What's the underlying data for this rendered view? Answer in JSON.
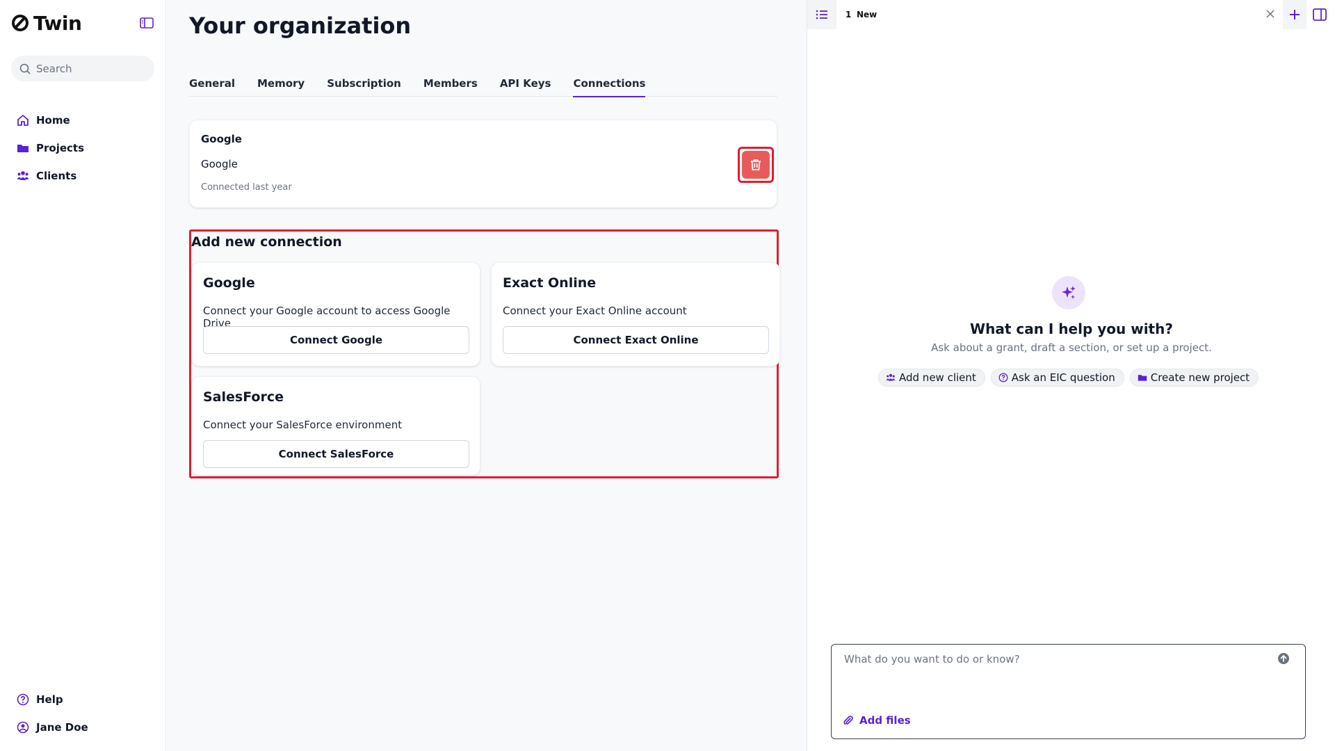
{
  "brand": {
    "name": "Twin",
    "accent": "#5b21d6",
    "danger": "#e85b5b",
    "highlight": "#e11d2e"
  },
  "sidebar": {
    "search_placeholder": "Search",
    "items": [
      {
        "label": "Home",
        "icon": "home-icon"
      },
      {
        "label": "Projects",
        "icon": "folder-icon"
      },
      {
        "label": "Clients",
        "icon": "users-icon"
      }
    ],
    "bottom": [
      {
        "label": "Help",
        "icon": "help-circle-icon"
      },
      {
        "label": "Jane Doe",
        "icon": "user-circle-icon"
      }
    ]
  },
  "main": {
    "title": "Your organization",
    "tabs": [
      {
        "label": "General",
        "active": false
      },
      {
        "label": "Memory",
        "active": false
      },
      {
        "label": "Subscription",
        "active": false
      },
      {
        "label": "Members",
        "active": false
      },
      {
        "label": "API Keys",
        "active": false
      },
      {
        "label": "Connections",
        "active": true
      }
    ],
    "connected": {
      "title": "Google",
      "name": "Google",
      "time": "Connected last year"
    },
    "add_new": {
      "title": "Add new connection",
      "cards": [
        {
          "title": "Google",
          "description": "Connect your Google account to access Google Drive",
          "button": "Connect Google"
        },
        {
          "title": "Exact Online",
          "description": "Connect your Exact Online account",
          "button": "Connect Exact Online"
        },
        {
          "title": "SalesForce",
          "description": "Connect your SalesForce environment",
          "button": "Connect SalesForce"
        }
      ]
    }
  },
  "assistant": {
    "tab_number": "1",
    "tab_label": "New",
    "heading": "What can I help you with?",
    "subheading": "Ask about a grant, draft a section, or set up a project.",
    "chips": [
      {
        "label": "Add new client",
        "icon": "users-icon"
      },
      {
        "label": "Ask an EIC question",
        "icon": "help-circle-icon"
      },
      {
        "label": "Create new project",
        "icon": "folder-icon"
      }
    ],
    "input_placeholder": "What do you want to do or know?",
    "add_files": "Add files"
  }
}
